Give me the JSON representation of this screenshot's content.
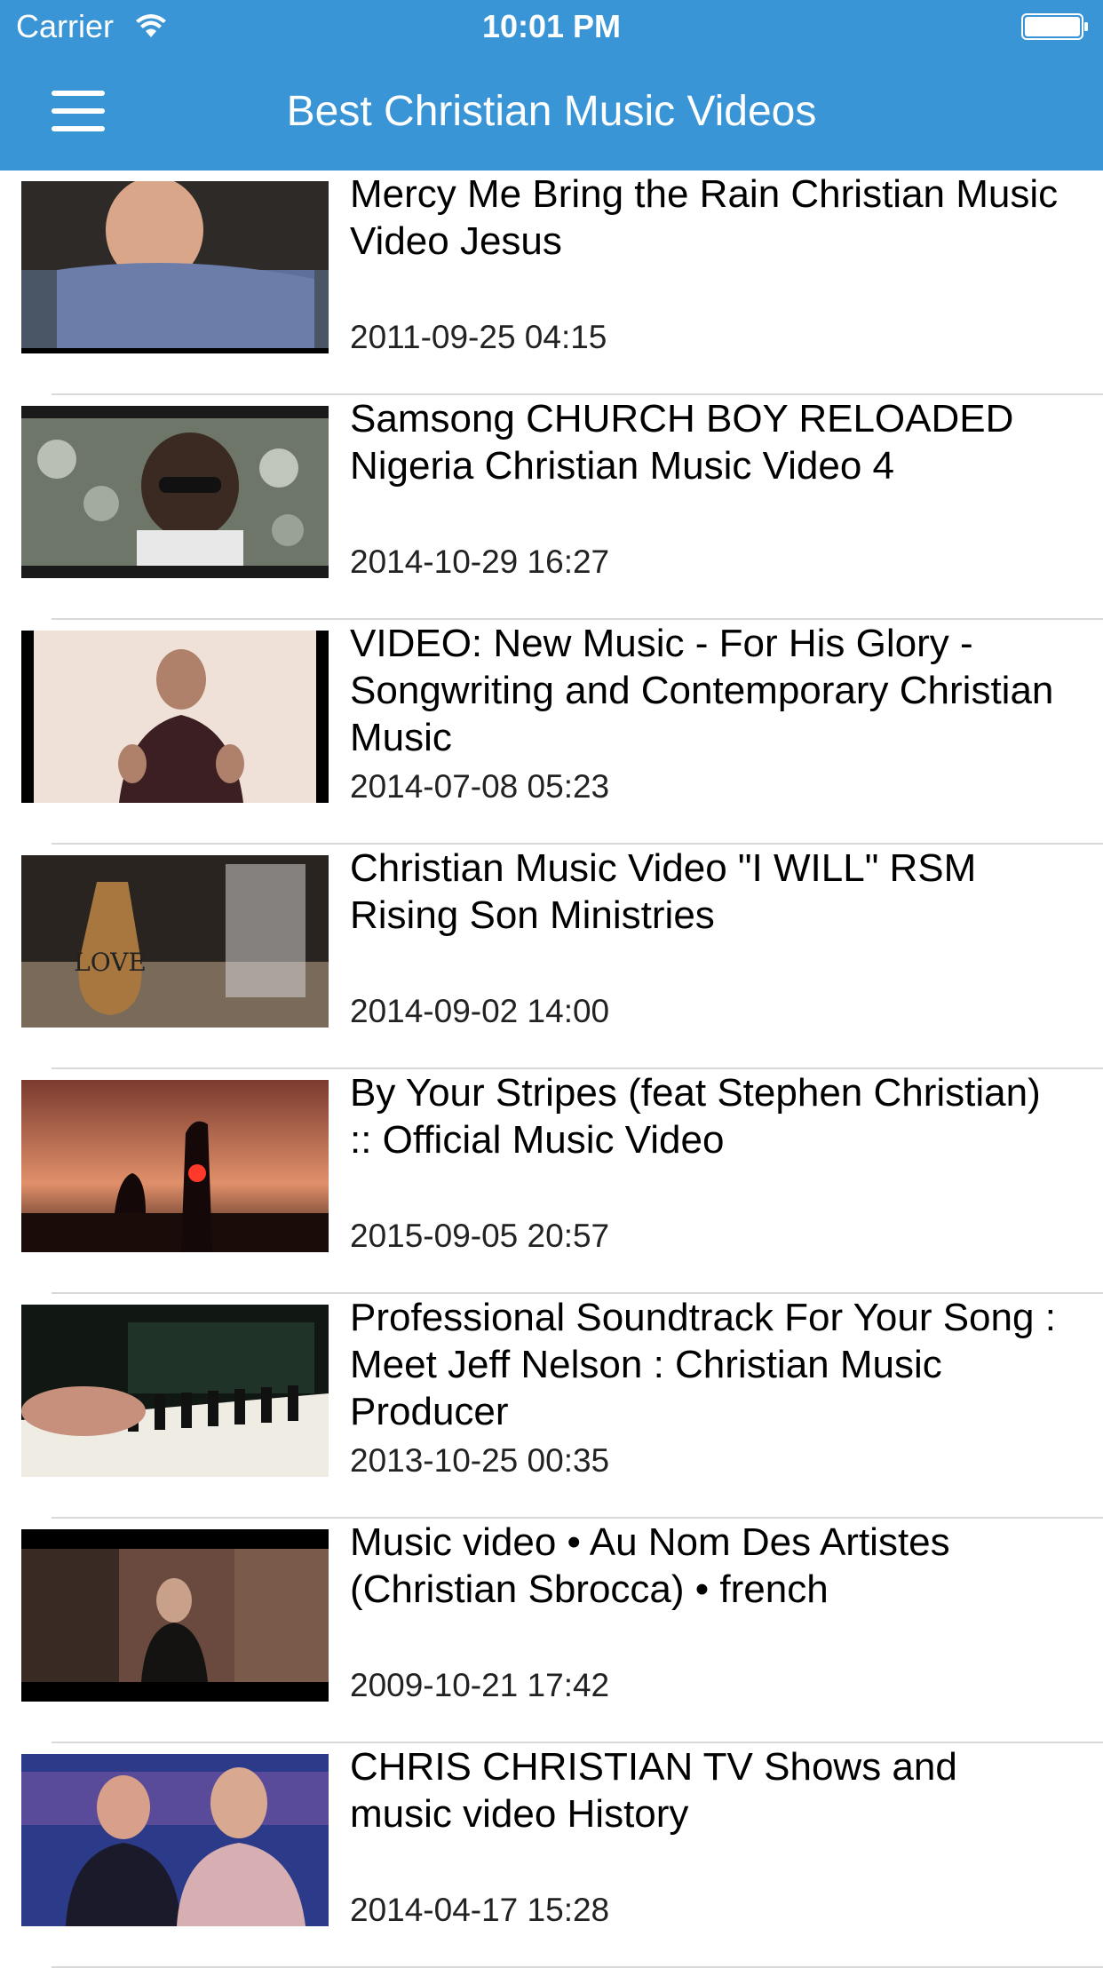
{
  "status_bar": {
    "carrier": "Carrier",
    "time": "10:01 PM"
  },
  "nav": {
    "title": "Best Christian Music Videos"
  },
  "colors": {
    "header": "#3a95d7",
    "separator": "#d9d9d9"
  },
  "videos": [
    {
      "title": "Mercy Me Bring the Rain Christian Music Video Jesus",
      "date": "2011-09-25 04:15"
    },
    {
      "title": "Samsong  CHURCH BOY RELOADED Nigeria Christian Music Video  4",
      "date": "2014-10-29 16:27"
    },
    {
      "title": "VIDEO: New Music - For His Glory - Songwriting and Contemporary Christian Music",
      "date": "2014-07-08 05:23"
    },
    {
      "title": "Christian Music Video \"I WILL\" RSM Rising Son Ministries",
      "date": "2014-09-02 14:00"
    },
    {
      "title": "By Your Stripes (feat Stephen Christian) :: Official Music Video",
      "date": "2015-09-05 20:57"
    },
    {
      "title": "Professional Soundtrack For Your Song : Meet Jeff Nelson : Christian Music Producer",
      "date": "2013-10-25 00:35"
    },
    {
      "title": "Music video • Au Nom Des Artistes (Christian Sbrocca) • french",
      "date": "2009-10-21 17:42"
    },
    {
      "title": "CHRIS CHRISTIAN TV Shows and music video History",
      "date": "2014-04-17 15:28"
    }
  ]
}
